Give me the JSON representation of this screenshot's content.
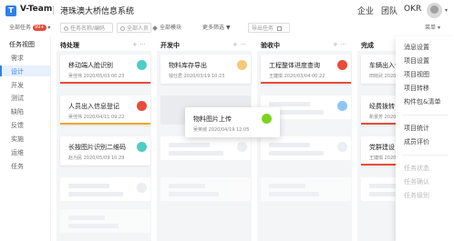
{
  "header": {
    "logo_mark": "T",
    "app_name": "V-Team",
    "project_title": "港珠澳大桥信息系统",
    "nav": [
      "企业",
      "团队",
      "OKR"
    ],
    "avatar_caret": "▾"
  },
  "toolbar": {
    "all_tasks": "全部任务",
    "all_tasks_count": "99+",
    "task_search_placeholder": "任务名称/编码",
    "all_members": "全部人员",
    "all_modules": "全部模块",
    "more_filters": "更多筛选",
    "export_tasks": "导出任务",
    "menu_label": "菜单"
  },
  "sidebar": {
    "title": "任务视图",
    "items": [
      "需求",
      "设计",
      "开发",
      "测试",
      "缺陷",
      "反馈",
      "实施",
      "运维",
      "任务"
    ],
    "active_index": 1
  },
  "columns": [
    {
      "title": "待处理",
      "ctrls": "+ ···"
    },
    {
      "title": "开发中",
      "ctrls": "+ ···"
    },
    {
      "title": "验收中",
      "ctrls": "+ ···"
    },
    {
      "title": "完成",
      "ctrls": ""
    }
  ],
  "cards": {
    "c1": {
      "title": "移动端人脸识别",
      "meta": "吴佳伟 2020/05/03 00:23",
      "dot": "#4ecdc4",
      "line": "#e74c3c"
    },
    "c2": {
      "title": "人员出入信息登记",
      "meta": "吴佳伟 2020/04/11 09:22",
      "dot": "#e74c3c",
      "line": "#f5a623"
    },
    "c3": {
      "title": "长按图片识别二维码",
      "meta": "赵为民 2020/05/09 10:29",
      "dot": "#4ecdc4",
      "line": ""
    },
    "c4": {
      "title": "物料库存导出",
      "meta": "钱仕君 2020/03/19 10:23",
      "dot": "#f5c97a",
      "line": ""
    },
    "c5": {
      "title": "工程整体进度查询",
      "meta": "王婕琪 2020/03/04 00:22",
      "dot": "#e74c3c",
      "line": "#e74c3c"
    },
    "c6": {
      "title": "车辆出入信",
      "meta": "田晓武 2020/",
      "dot": "",
      "line": ""
    },
    "c7": {
      "title": "经费拨转",
      "meta": "新景芳 2020/",
      "dot": "",
      "line": "#e74c3c"
    },
    "c8": {
      "title": "党群建设",
      "meta": "王婕琪 2020/",
      "dot": "",
      "line": "#e74c3c"
    },
    "drag": {
      "title": "物料图片上传",
      "meta": "吴英城 2020/04/19 12:05",
      "dot": "#7ed321"
    }
  },
  "menu": {
    "group1": [
      "消息设置",
      "项目设置",
      "项目视图",
      "项目转移",
      "构件包&清单"
    ],
    "group2": [
      "项目统计",
      "成员评价"
    ],
    "group3": [
      "任务状态",
      "任务确认",
      "任务级别"
    ]
  }
}
